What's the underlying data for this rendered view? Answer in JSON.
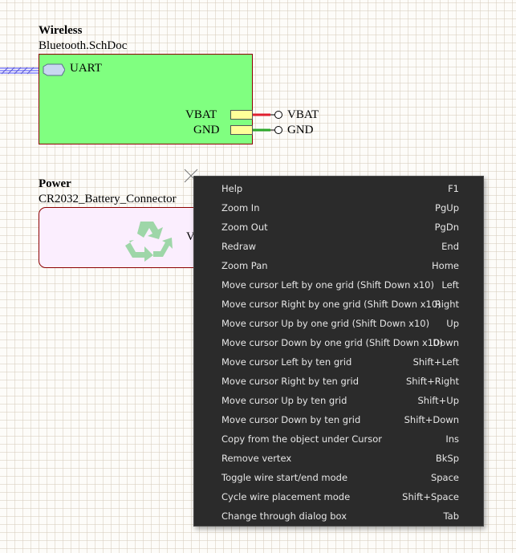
{
  "schematic": {
    "wireless": {
      "title": "Wireless",
      "file": "Bluetooth.SchDoc",
      "port_label": "UART",
      "entries": [
        "VBAT",
        "GND"
      ],
      "net_labels": [
        "VBAT",
        "GND"
      ]
    },
    "power": {
      "title": "Power",
      "file": "CR2032_Battery_Connector",
      "partial_label": "V"
    }
  },
  "colors": {
    "wireless_fill": "#80ff80",
    "power_fill": "#fbeefe",
    "sheet_border": "#8b0000",
    "menu_bg": "#2b2b2b",
    "vbat_wire": "#e0202f",
    "gnd_wire": "#2aa82a",
    "bus": "#8080ff"
  },
  "context_menu": {
    "items": [
      {
        "label": "Help",
        "shortcut": "F1"
      },
      {
        "label": "Zoom In",
        "shortcut": "PgUp"
      },
      {
        "label": "Zoom Out",
        "shortcut": "PgDn"
      },
      {
        "label": "Redraw",
        "shortcut": "End"
      },
      {
        "label": "Zoom Pan",
        "shortcut": "Home"
      },
      {
        "label": "Move cursor Left by one grid (Shift Down x10)",
        "shortcut": "Left"
      },
      {
        "label": "Move cursor Right by one grid (Shift Down x10)",
        "shortcut": "Right"
      },
      {
        "label": "Move cursor Up by one grid (Shift Down x10)",
        "shortcut": "Up"
      },
      {
        "label": "Move cursor Down by one grid (Shift Down x10)",
        "shortcut": "Down"
      },
      {
        "label": "Move cursor Left by ten grid",
        "shortcut": "Shift+Left"
      },
      {
        "label": "Move cursor Right by ten grid",
        "shortcut": "Shift+Right"
      },
      {
        "label": "Move cursor Up by ten grid",
        "shortcut": "Shift+Up"
      },
      {
        "label": "Move cursor Down by ten grid",
        "shortcut": "Shift+Down"
      },
      {
        "label": "Copy from the object under Cursor",
        "shortcut": "Ins"
      },
      {
        "label": "Remove vertex",
        "shortcut": "BkSp"
      },
      {
        "label": "Toggle wire start/end mode",
        "shortcut": "Space"
      },
      {
        "label": "Cycle wire placement mode",
        "shortcut": "Shift+Space"
      },
      {
        "label": "Change through dialog box",
        "shortcut": "Tab"
      }
    ]
  }
}
